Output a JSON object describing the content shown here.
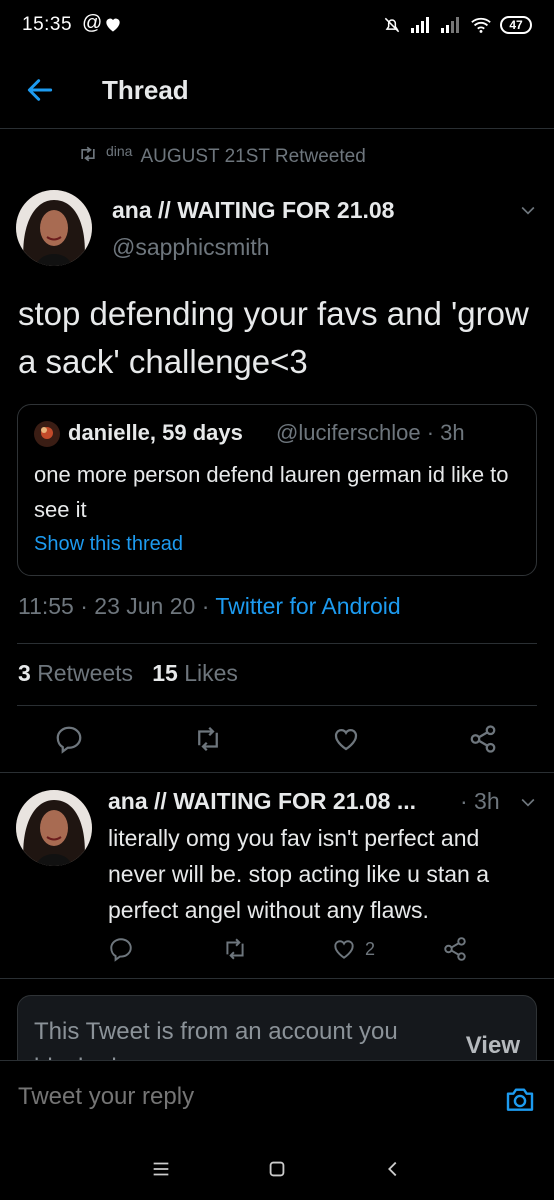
{
  "status_bar": {
    "time": "15:35",
    "at_symbol": "@",
    "battery": "47"
  },
  "header": {
    "title": "Thread"
  },
  "retweet": {
    "user": "dina",
    "suffix": "AUGUST 21ST Retweeted"
  },
  "tweet": {
    "author_name": "ana // WAITING FOR 21.08",
    "author_handle": "@sapphicsmith",
    "text": "stop defending your favs and 'grow a sack' challenge<3",
    "quote": {
      "name": "danielle, 59 days",
      "handle": "@luciferschloe · 3h",
      "text": "one more person defend lauren german id like to see it",
      "show_thread": "Show this thread"
    },
    "time": "11:55 · 23 Jun 20 · ",
    "source": "Twitter for Android",
    "retweets_count": "3",
    "retweets_label": "Retweets",
    "likes_count": "15",
    "likes_label": "Likes"
  },
  "reply": {
    "author_name": "ana // WAITING FOR 21.08 ...",
    "time": "· 3h",
    "text": "literally omg you fav isn't perfect and never will be. stop acting like u stan a perfect angel without any flaws.",
    "like_count": "2"
  },
  "blocked": {
    "text": "This Tweet is from an account you blocked.",
    "view_label": "View"
  },
  "compose": {
    "placeholder": "Tweet your reply"
  },
  "colors": {
    "background": "#000000",
    "accent": "#1d9bf0",
    "muted": "#6e767d",
    "text": "#e7e9ea"
  }
}
